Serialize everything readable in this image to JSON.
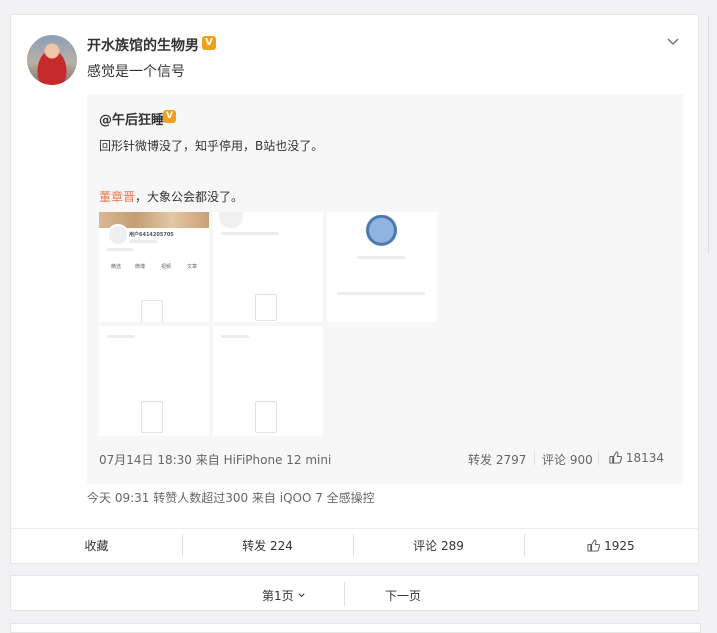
{
  "post": {
    "author": "开水族馆的生物男",
    "verified_badge": "V",
    "text": "感觉是一个信号",
    "meta": "今天 09:31 转赞人数超过300  来自 iQOO 7 全感操控"
  },
  "repost": {
    "author": "@午后狂睡",
    "verified_badge": "V",
    "line1": "回形针微博没了，知乎停用，B站也没了。",
    "mention": "董章晋",
    "line2_rest": "，大象公会都没了。",
    "image1_username": "用户6414205705",
    "image1_tabs": [
      "精选",
      "微博",
      "视频",
      "文章"
    ],
    "time_source": "07月14日 18:30 来自 HiFiPhone 12 mini",
    "forward": "转发 2797",
    "comment": "评论 900",
    "likes": "18134"
  },
  "actions": {
    "favorite": "收藏",
    "forward": "转发 224",
    "comment": "评论 289",
    "like": "1925"
  },
  "pager": {
    "current_page": "第1页",
    "next_page": "下一页"
  },
  "colors": {
    "mention": "#eb7350",
    "badge": "#f0a01b"
  }
}
